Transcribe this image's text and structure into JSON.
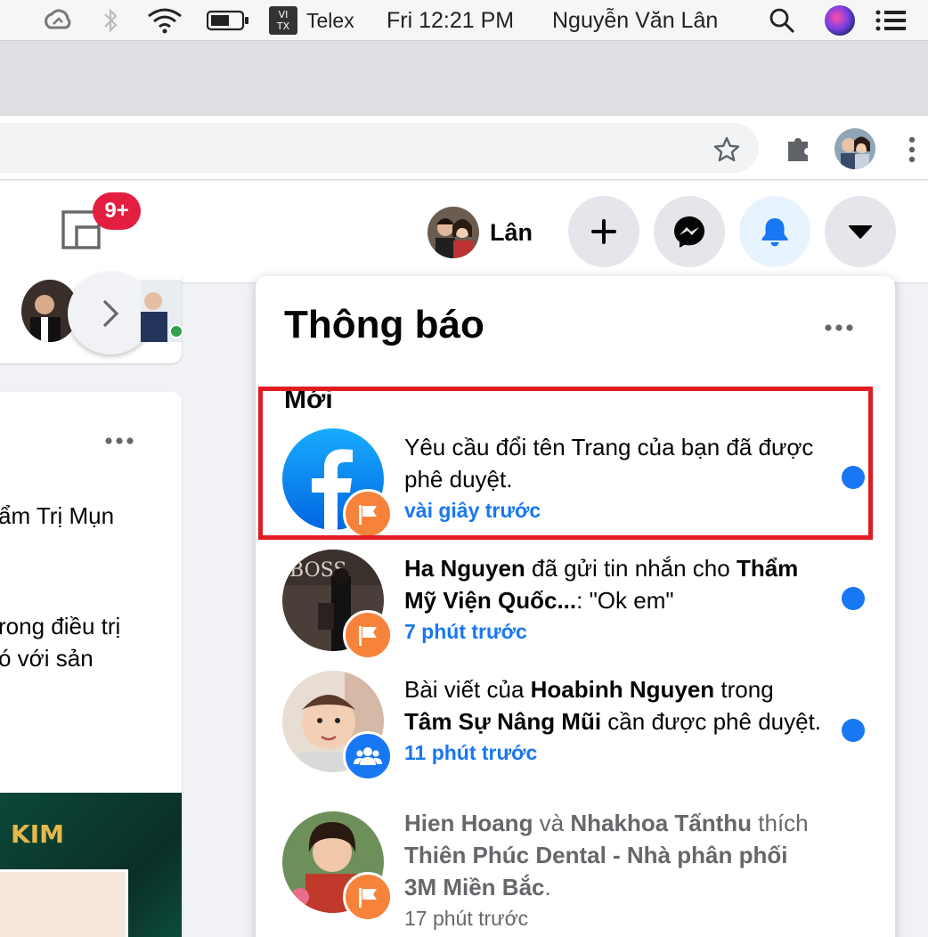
{
  "menubar": {
    "input_method_label": "Telex",
    "input_badge_line1": "VI",
    "input_badge_line2": "TX",
    "clock": "Fri 12:21 PM",
    "user_name": "Nguyễn Văn Lân"
  },
  "header": {
    "notification_badge": "9+",
    "profile_name": "Lân"
  },
  "feed": {
    "line1": "ẩm Trị Mụn",
    "line2": "rong điều trị",
    "line3": "ó với sản",
    "ad_text": "KIM"
  },
  "notifications_panel": {
    "title": "Thông báo",
    "section_new": "Mới",
    "items": [
      {
        "parts": [
          {
            "text": "Yêu cầu đổi tên Trang của bạn đã được phê duyệt.",
            "bold": false
          }
        ],
        "time": "vài giây trước",
        "badge_icon": "flag-icon",
        "unread": true
      },
      {
        "parts": [
          {
            "text": "Ha Nguyen",
            "bold": true
          },
          {
            "text": " đã gửi tin nhắn cho ",
            "bold": false
          },
          {
            "text": "Thẩm Mỹ Viện Quốc...",
            "bold": true
          },
          {
            "text": ": \"Ok em\"",
            "bold": false
          }
        ],
        "time": "7 phút trước",
        "badge_icon": "flag-icon",
        "unread": true
      },
      {
        "parts": [
          {
            "text": "Bài viết của ",
            "bold": false
          },
          {
            "text": "Hoabinh Nguyen",
            "bold": true
          },
          {
            "text": " trong ",
            "bold": false
          },
          {
            "text": "Tâm Sự Nâng Mũi",
            "bold": true
          },
          {
            "text": " cần được phê duyệt.",
            "bold": false
          }
        ],
        "time": "11 phút trước",
        "badge_icon": "group-icon",
        "unread": true
      },
      {
        "parts": [
          {
            "text": "Hien Hoang",
            "bold": true
          },
          {
            "text": " và ",
            "bold": false
          },
          {
            "text": "Nhakhoa Tấnthu",
            "bold": true
          },
          {
            "text": " thích ",
            "bold": false
          },
          {
            "text": "Thiên Phúc Dental - Nhà phân phối 3M Miền Bắc",
            "bold": true
          },
          {
            "text": ".",
            "bold": false
          }
        ],
        "time": "17 phút trước",
        "badge_icon": "flag-icon",
        "unread": false
      }
    ]
  },
  "colors": {
    "facebook_blue": "#1877f2",
    "highlight_red": "#e11b22",
    "badge_red": "#e41e3f",
    "page_badge_orange": "#f7823a"
  }
}
